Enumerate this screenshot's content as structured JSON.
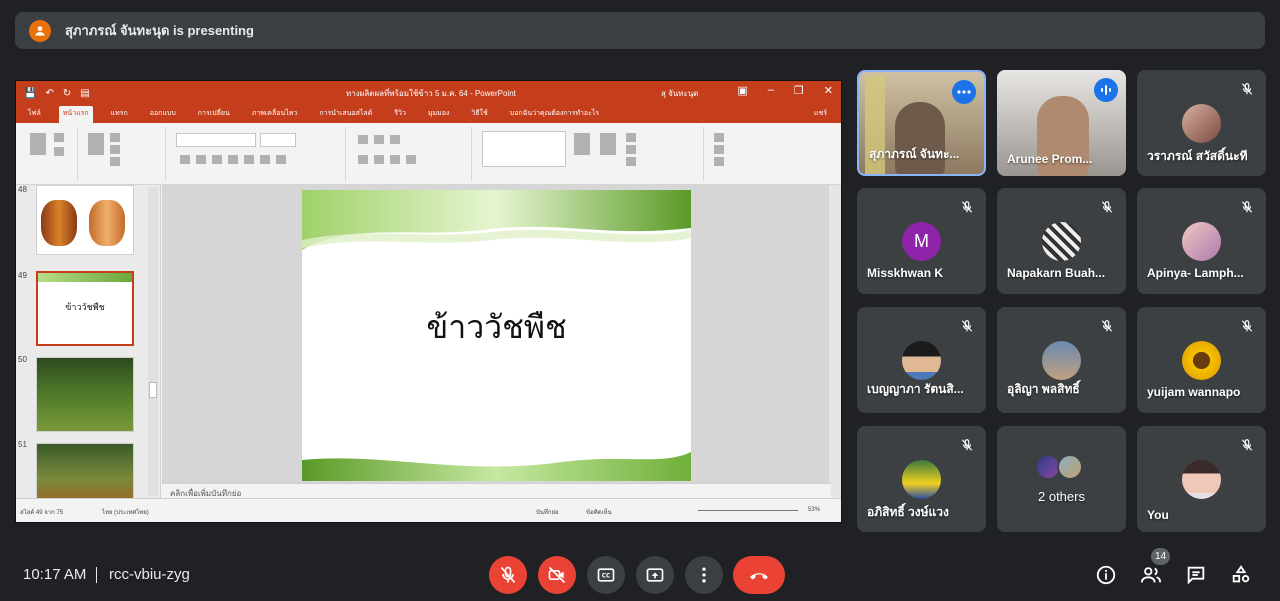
{
  "banner": {
    "text": "สุภาภรณ์ จันทะนุด is presenting"
  },
  "powerpoint": {
    "window_title": "ทางผลิตผลที่พร้อมใช้ข้าว 5 ม.ค. 64 - PowerPoint",
    "user": "สุ จันทะนุด",
    "tabs": [
      "ไฟล์",
      "หน้าแรก",
      "แทรก",
      "ออกแบบ",
      "การเปลี่ยน",
      "ภาพเคลื่อนไหว",
      "การนำเสนอสไลด์",
      "รีวิว",
      "มุมมอง",
      "วิธีใช้",
      "บอกฉันว่าคุณต้องการทำอะไร"
    ],
    "share_label": "แชร์",
    "thumbnails": [
      {
        "number": "48"
      },
      {
        "number": "49",
        "text": "ข้าววัชพืช"
      },
      {
        "number": "50"
      },
      {
        "number": "51"
      }
    ],
    "slide_title": "ข้าววัชพืช",
    "notes_placeholder": "คลิกเพื่อเพิ่มบันทึกย่อ",
    "status_left": "สไลด์ 49 จาก 75",
    "status_lang": "ไทย (ประเทศไทย)",
    "status_notes": "บันทึกย่อ",
    "status_comments": "ข้อคิดเห็น",
    "zoom": "53%"
  },
  "participants": [
    {
      "name": "สุภาภรณ์ จันทะ...",
      "muted": false,
      "video": true,
      "status": "more"
    },
    {
      "name": "Arunee Prom...",
      "muted": false,
      "video": true,
      "status": "speaking"
    },
    {
      "name": "วราภรณ์ สวัสดิ์นะที",
      "muted": true
    },
    {
      "name": "Misskhwan K",
      "muted": true,
      "initial": "M",
      "color": "#8e24aa"
    },
    {
      "name": "Napakarn Buah...",
      "muted": true
    },
    {
      "name": "Apinya- Lamph...",
      "muted": true
    },
    {
      "name": "เบญญาภา รัตนสิ...",
      "muted": true
    },
    {
      "name": "อุลิญา พลสิทธิ์",
      "muted": true
    },
    {
      "name": "yuijam wannapo",
      "muted": true
    },
    {
      "name": "อภิสิทธิ์ วงษ์แวง",
      "muted": true
    },
    {
      "name": "2 others",
      "muted": false
    },
    {
      "name": "You",
      "muted": true
    }
  ],
  "bottom_bar": {
    "time": "10:17 AM",
    "meeting_code": "rcc-vbiu-zyg",
    "people_count": "14"
  },
  "colors": {
    "background": "#202124",
    "tile": "#3c4043",
    "danger": "#ea4335",
    "ppt_accent": "#c43e1c",
    "active_border": "#8ab4f8"
  }
}
